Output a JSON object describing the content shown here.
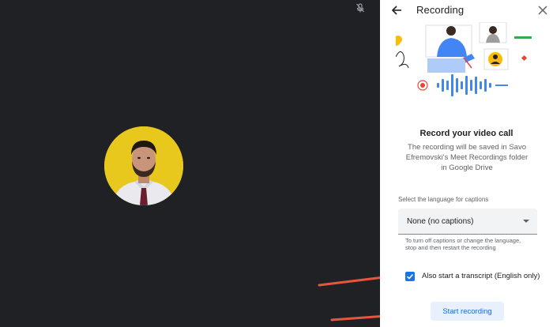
{
  "colors": {
    "video_bg": "#202124",
    "panel_bg": "#ffffff",
    "accent_blue": "#1a73e8",
    "button_bg": "#e8f0fe",
    "annotation_red": "#e8553e",
    "avatar_bg": "#e8c81c"
  },
  "video": {
    "mic_icon": "mic-off-icon",
    "avatar_icon": "participant-avatar"
  },
  "panel": {
    "title": "Recording",
    "back_icon": "arrow-back-icon",
    "close_icon": "close-icon",
    "heading": "Record your video call",
    "description": "The recording will be saved in Savo Efremovski's Meet Recordings folder in Google Drive",
    "language_label": "Select the language for captions",
    "language_value": "None (no captions)",
    "language_hint": "To turn off captions or change the language, stop and then restart the recording",
    "transcript_label": "Also start a transcript (English only)",
    "transcript_checked": true,
    "start_button": "Start recording"
  }
}
